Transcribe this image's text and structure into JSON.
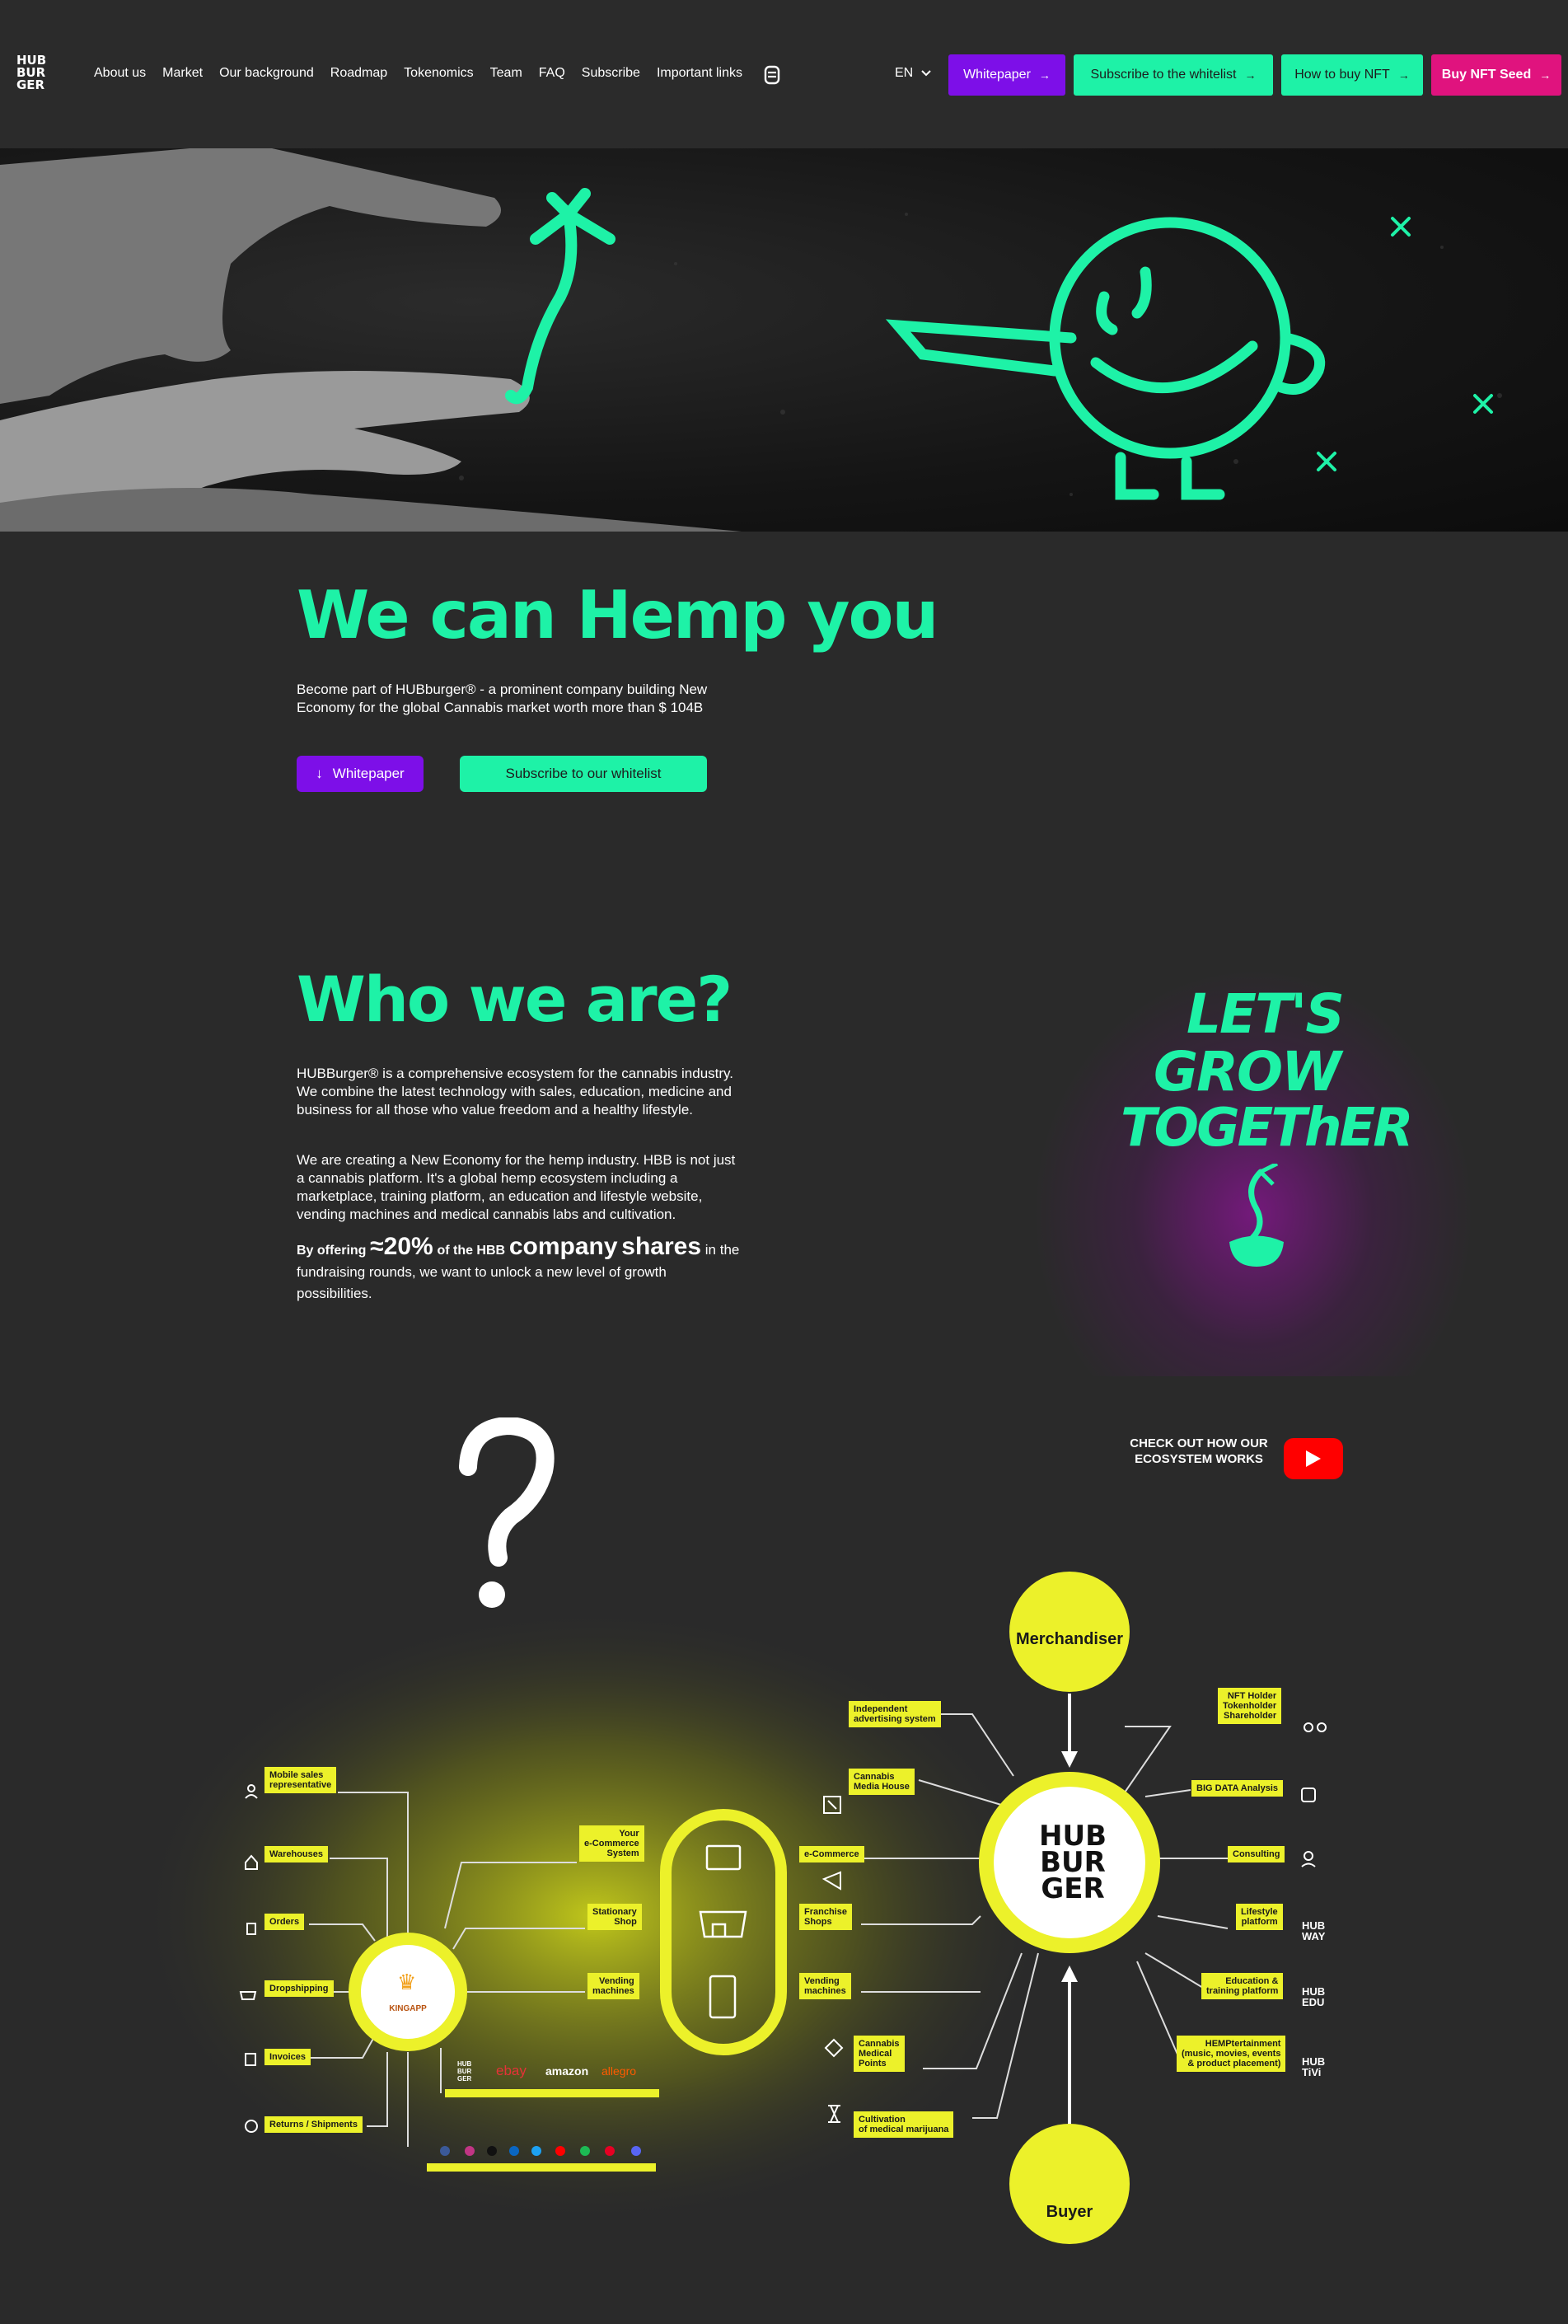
{
  "header": {
    "logo": [
      "HUB",
      "BUR",
      "GER"
    ],
    "nav": [
      "About us",
      "Market",
      "Our background",
      "Roadmap",
      "Tokenomics",
      "Team",
      "FAQ",
      "Subscribe",
      "Important links"
    ],
    "lang": "EN",
    "buttons": {
      "whitepaper": "Whitepaper",
      "whitelist": "Subscribe to the whitelist",
      "how_to_buy": "How to buy NFT",
      "buy_seed": "Buy NFT Seed"
    }
  },
  "hero_section": {
    "title": "We can Hemp you",
    "text": "Become part of HUBburger® - a prominent company building New Economy for the global Cannabis market worth more than $ 104B",
    "cta_whitepaper": "Whitepaper",
    "cta_whitelist": "Subscribe to our whitelist"
  },
  "who": {
    "title": "Who we are?",
    "p1": "HUBBurger® is a comprehensive ecosystem for the cannabis industry. We combine the latest technology with sales, education, medicine and business for all those who value freedom and a healthy lifestyle.",
    "p2": "We are creating a New Economy for the hemp industry. HBB is not just a cannabis platform. It's a global hemp ecosystem including a marketplace, training platform, an education and lifestyle website, vending machines and medical cannabis labs and cultivation.",
    "offer_a": "By offering",
    "offer_b": "≈20%",
    "offer_c": "of the HBB",
    "offer_d": "company",
    "offer_e": "shares",
    "offer_f": "in the fundraising rounds, we want to unlock a new level of growth possibilities.",
    "slogan": [
      "LET'S",
      "GROW",
      "TOGEThER"
    ]
  },
  "ecosystem": {
    "video_text": "CHECK OUT HOW OUR ECOSYSTEM WORKS",
    "merchandiser": "Merchandiser",
    "buyer": "Buyer",
    "center_logo": [
      "HUB",
      "BUR",
      "GER"
    ],
    "kingapp": "KINGAPP",
    "left_tags": [
      "Mobile sales\nrepresentative",
      "Warehouses",
      "Orders",
      "Dropshipping",
      "Invoices",
      "Returns / Shipments"
    ],
    "middle_left_tags": [
      "Your\ne-Commerce\nSystem",
      "Stationary\nShop",
      "Vending\nmachines"
    ],
    "middle_right_tags": [
      "e-Commerce",
      "Franchise\nShops",
      "Vending\nmachines"
    ],
    "center_left_tags": [
      "Independent\nadvertising system",
      "Cannabis\nMedia House",
      "Cannabis\nMedical\nPoints",
      "Cultivation\nof medical marijuana"
    ],
    "right_tags": [
      "NFT Holder\nTokenholder\nShareholder",
      "BIG DATA Analysis",
      "Consulting",
      "Lifestyle\nplatform",
      "Education &\ntraining platform",
      "HEMPtertainment\n(music, movies, events\n& product placement)"
    ],
    "marketplaces": [
      "HUB BUR GER",
      "ebay",
      "amazon",
      "allegro"
    ],
    "sub_brands": [
      "HUB WAY",
      "HUB EDU",
      "HUB TiVi"
    ]
  },
  "colors": {
    "accent_green": "#1ef2a7",
    "purple": "#7d0fe8",
    "pink": "#e0137e",
    "yellow": "#ecf12a",
    "bg": "#2a2a2a"
  }
}
